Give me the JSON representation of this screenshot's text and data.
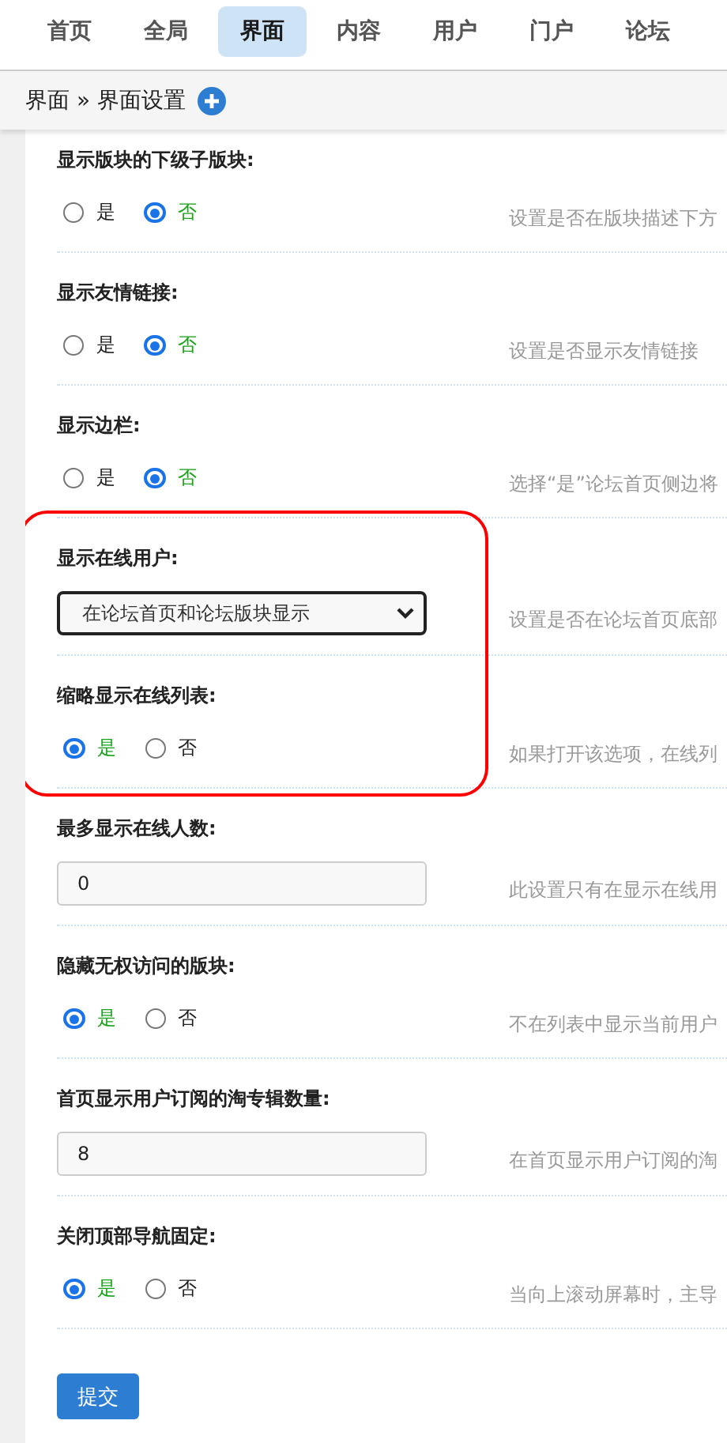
{
  "tabs": [
    {
      "label": "首页",
      "selected": false
    },
    {
      "label": "全局",
      "selected": false
    },
    {
      "label": "界面",
      "selected": true
    },
    {
      "label": "内容",
      "selected": false
    },
    {
      "label": "用户",
      "selected": false
    },
    {
      "label": "门户",
      "selected": false
    },
    {
      "label": "论坛",
      "selected": false
    }
  ],
  "breadcrumb": "界面 » 界面设置",
  "sections": [
    {
      "kind": "radio",
      "label": "显示版块的下级子版块:",
      "highlighted": false,
      "options": [
        {
          "label": "是",
          "selected": false
        },
        {
          "label": "否",
          "selected": true
        }
      ],
      "description": "设置是否在版块描述下方"
    },
    {
      "kind": "radio",
      "label": "显示友情链接:",
      "highlighted": false,
      "options": [
        {
          "label": "是",
          "selected": false
        },
        {
          "label": "否",
          "selected": true
        }
      ],
      "description": "设置是否显示友情链接"
    },
    {
      "kind": "radio",
      "label": "显示边栏:",
      "highlighted": false,
      "options": [
        {
          "label": "是",
          "selected": false
        },
        {
          "label": "否",
          "selected": true
        }
      ],
      "description": "选择“是”论坛首页侧边将"
    },
    {
      "kind": "select",
      "label": "显示在线用户:",
      "highlighted": true,
      "value": "在论坛首页和论坛版块显示",
      "description": "设置是否在论坛首页底部"
    },
    {
      "kind": "radio",
      "label": "缩略显示在线列表:",
      "highlighted": true,
      "options": [
        {
          "label": "是",
          "selected": true
        },
        {
          "label": "否",
          "selected": false
        }
      ],
      "description": "如果打开该选项，在线列"
    },
    {
      "kind": "text",
      "label": "最多显示在线人数:",
      "highlighted": false,
      "value": "0",
      "description": "此设置只有在显示在线用"
    },
    {
      "kind": "radio",
      "label": "隐藏无权访问的版块:",
      "highlighted": false,
      "options": [
        {
          "label": "是",
          "selected": true
        },
        {
          "label": "否",
          "selected": false
        }
      ],
      "description": "不在列表中显示当前用户"
    },
    {
      "kind": "text",
      "label": "首页显示用户订阅的淘专辑数量:",
      "highlighted": false,
      "value": "8",
      "description": "在首页显示用户订阅的淘"
    },
    {
      "kind": "radio",
      "label": "关闭顶部导航固定:",
      "highlighted": false,
      "options": [
        {
          "label": "是",
          "selected": true
        },
        {
          "label": "否",
          "selected": false
        }
      ],
      "description": "当向上滚动屏幕时，主导"
    }
  ],
  "submit": "提交"
}
